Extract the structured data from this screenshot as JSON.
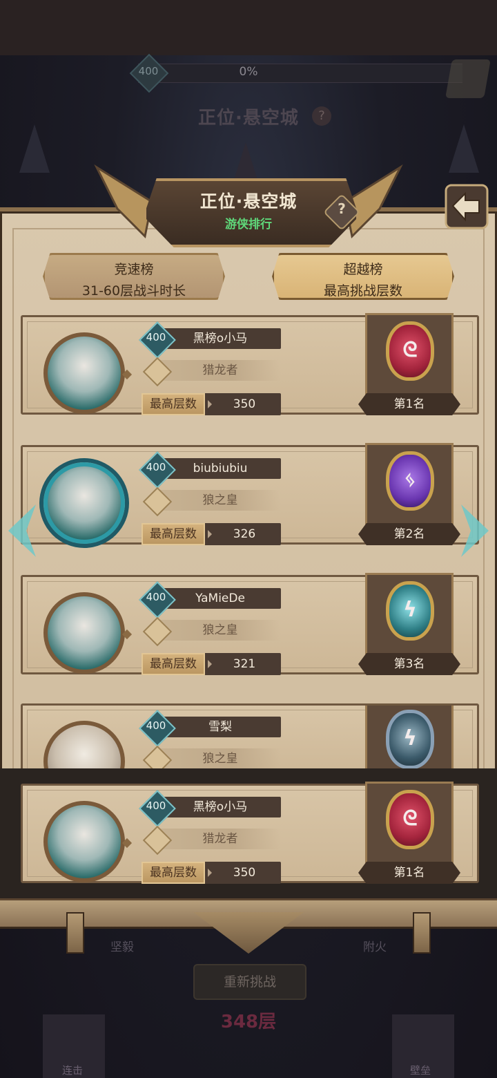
{
  "background": {
    "level": "400",
    "progress": "0%",
    "title": "正位·悬空城",
    "help_icon": "?",
    "left_label": "坚毅",
    "right_label": "附火",
    "retry_label": "重新挑战",
    "floor_label": "348层",
    "corner_left_label": "连击",
    "corner_right_label": "壁垒"
  },
  "header": {
    "title": "正位·悬空城",
    "subtitle": "游侠排行",
    "help_icon": "?"
  },
  "tabs": [
    {
      "title": "竞速榜",
      "subtitle": "31-60层战斗时长",
      "selected": false
    },
    {
      "title": "超越榜",
      "subtitle": "最高挑战层数",
      "selected": true
    }
  ],
  "rankings": [
    {
      "level": "400",
      "name": "黑榜o小马",
      "title": "猎龙者",
      "stat_label": "最高层数",
      "stat_value": "350",
      "rank": "第1名",
      "gem_color": "#a3243c"
    },
    {
      "level": "400",
      "name": "biubiubiu",
      "title": "狼之皇",
      "stat_label": "最高层数",
      "stat_value": "326",
      "rank": "第2名",
      "gem_color": "#6a36b0"
    },
    {
      "level": "400",
      "name": "YaMieDe",
      "title": "狼之皇",
      "stat_label": "最高层数",
      "stat_value": "321",
      "rank": "第3名",
      "gem_color": "#2f7f86"
    },
    {
      "level": "400",
      "name": "雪梨",
      "title": "狼之皇",
      "stat_label": "",
      "stat_value": "",
      "rank": "",
      "gem_color": "#3b5a6a"
    }
  ],
  "my_rank": {
    "level": "400",
    "name": "黑榜o小马",
    "title": "猎龙者",
    "stat_label": "最高层数",
    "stat_value": "350",
    "rank": "第1名",
    "gem_color": "#a3243c"
  }
}
